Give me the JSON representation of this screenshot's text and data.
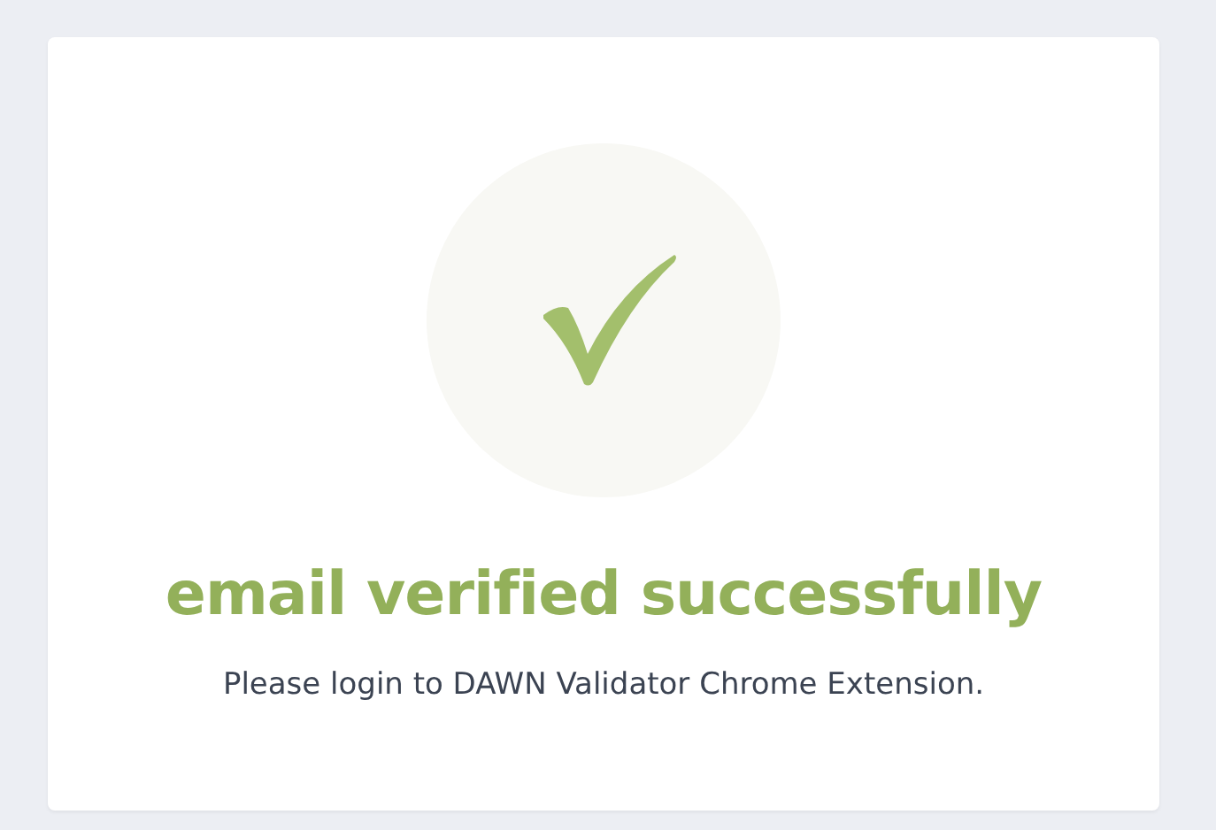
{
  "heading": "email verified successfully",
  "message": "Please login to DAWN Validator Chrome Extension."
}
